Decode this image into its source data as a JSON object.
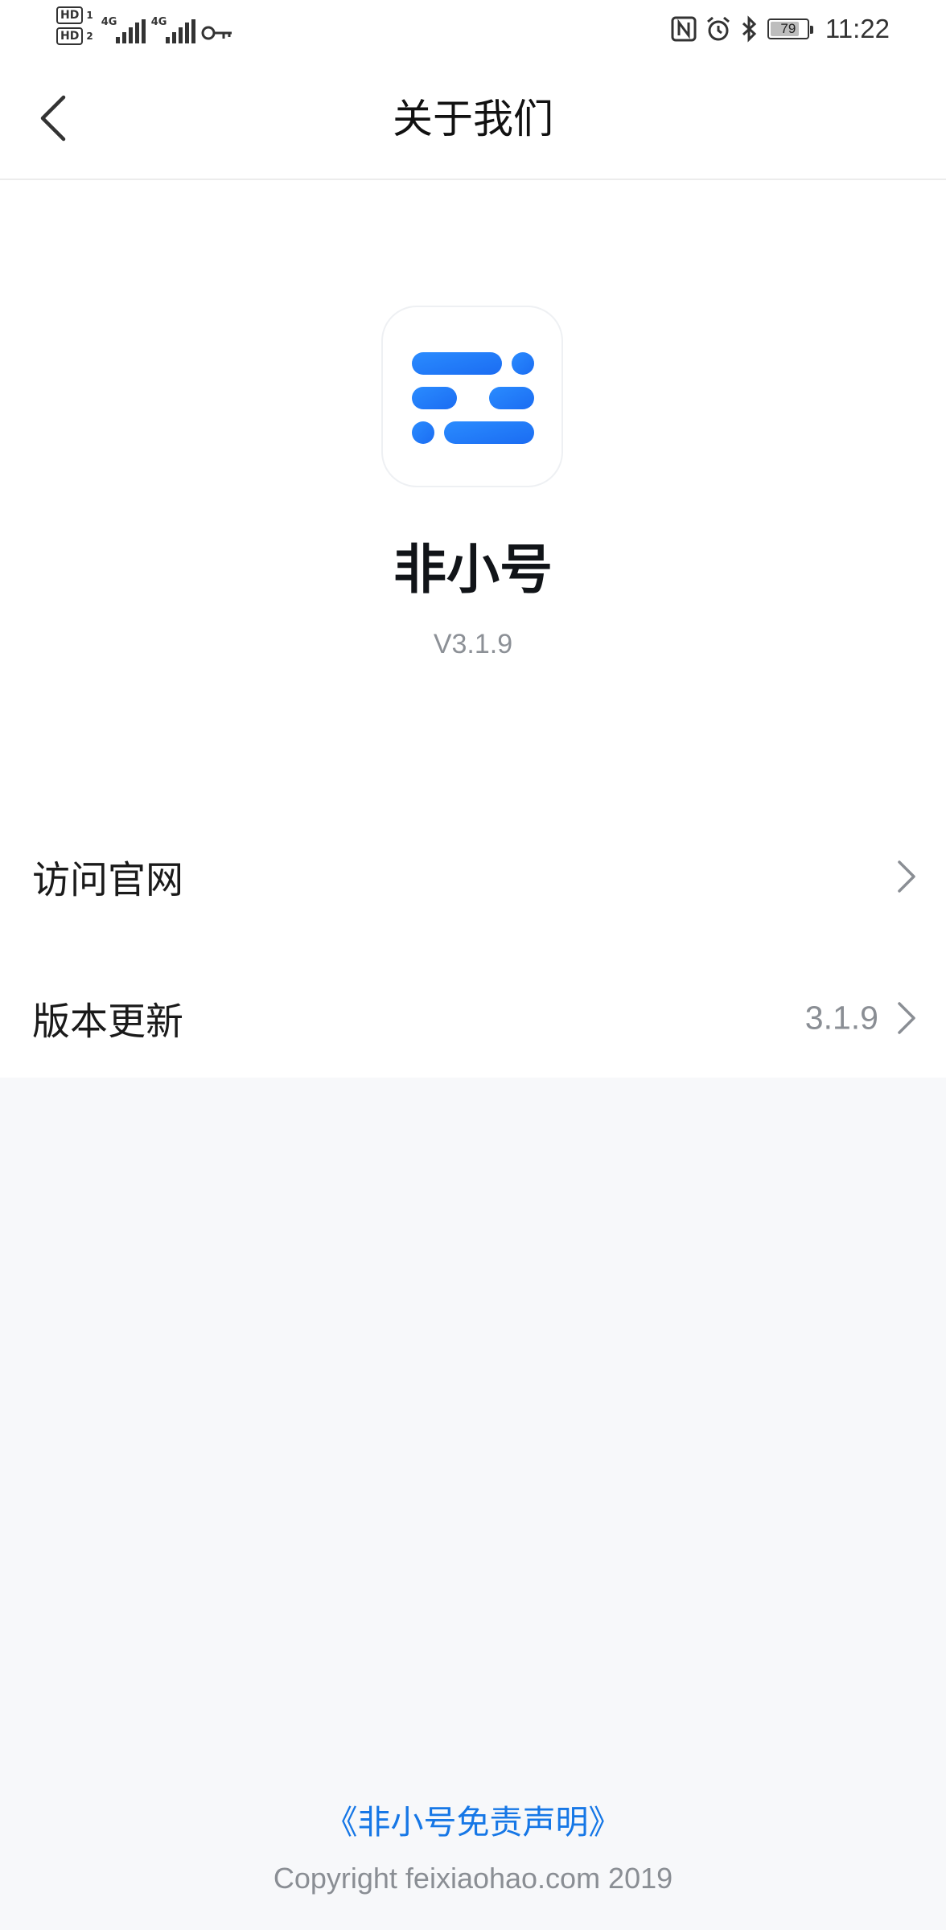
{
  "status_bar": {
    "sim1_label": "HD",
    "sim1_index": "1",
    "sim2_label": "HD",
    "sim2_index": "2",
    "network1": "4G",
    "network2": "4G",
    "battery_level": "79",
    "battery_fraction": 0.79,
    "time": "11:22",
    "icons": [
      "vpn-key-icon",
      "nfc-icon",
      "alarm-icon",
      "bluetooth-icon",
      "battery-icon"
    ]
  },
  "nav": {
    "title": "关于我们",
    "back_icon": "chevron-left-icon"
  },
  "app": {
    "name": "非小号",
    "version": "V3.1.9",
    "logo_colors": [
      "#2a8cff",
      "#1b6cf2"
    ]
  },
  "menu": {
    "items": [
      {
        "label": "访问官网",
        "value": ""
      },
      {
        "label": "版本更新",
        "value": "3.1.9"
      }
    ]
  },
  "footer": {
    "disclaimer": "《非小号免责声明》",
    "copyright": "Copyright feixiaohao.com 2019"
  },
  "colors": {
    "accent": "#1677e6",
    "text_primary": "#111418",
    "text_secondary": "#8a8e94",
    "background": "#f7f8fa"
  }
}
